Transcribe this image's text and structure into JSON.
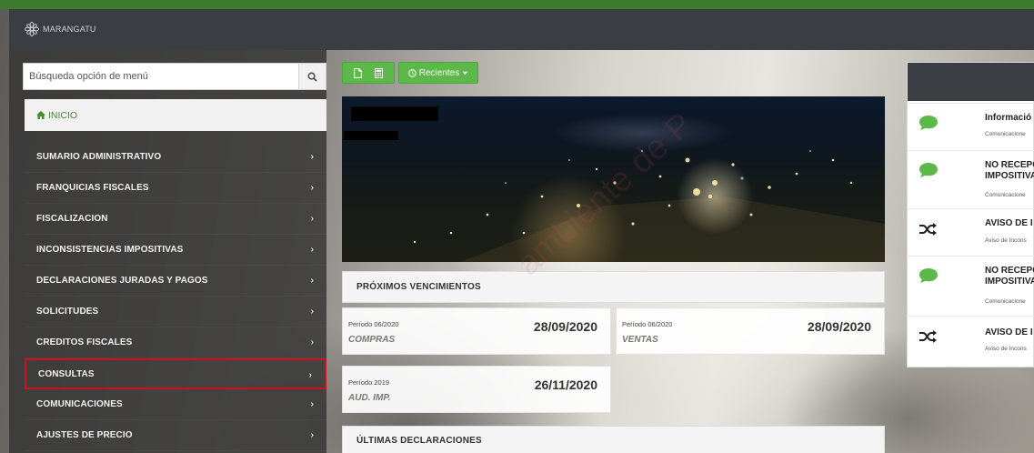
{
  "brand": {
    "name": "MARANGATU"
  },
  "colors": {
    "accent": "#5cb848",
    "topbar": "#3a3d42",
    "highlight": "#d0111b"
  },
  "search": {
    "placeholder": "Búsqueda opción de menú",
    "icon": "search-icon"
  },
  "home": {
    "label": "INICIO",
    "icon": "home-icon"
  },
  "menu": {
    "items": [
      {
        "label": "SUMARIO ADMINISTRATIVO"
      },
      {
        "label": "FRANQUICIAS FISCALES"
      },
      {
        "label": "FISCALIZACION"
      },
      {
        "label": "INCONSISTENCIAS IMPOSITIVAS"
      },
      {
        "label": "DECLARACIONES JURADAS Y PAGOS"
      },
      {
        "label": "SOLICITUDES"
      },
      {
        "label": "CREDITOS FISCALES"
      },
      {
        "label": "CONSULTAS"
      },
      {
        "label": "COMUNICACIONES"
      },
      {
        "label": "AJUSTES DE PRECIO"
      }
    ],
    "chevron": "›"
  },
  "toolbar": {
    "new_doc_icon": "file-icon",
    "calc_icon": "calculator-icon",
    "recent_label": "Recientes"
  },
  "due": {
    "title": "PRÓXIMOS VENCIMIENTOS",
    "cards": [
      {
        "period": "Período 06/2020",
        "date": "28/09/2020",
        "type": "COMPRAS"
      },
      {
        "period": "Período 06/2020",
        "date": "28/09/2020",
        "type": "VENTAS"
      },
      {
        "period": "Período 2019",
        "date": "26/11/2020",
        "type": "AUD. IMP."
      }
    ]
  },
  "last_declarations": {
    "title": "ÚLTIMAS DECLARACIONES"
  },
  "notifications": [
    {
      "icon": "comment-icon",
      "title": [
        "Informació"
      ],
      "sub": "Comunicacione"
    },
    {
      "icon": "comment-icon",
      "title": [
        "NO RECEPC",
        "IMPOSITIVA"
      ],
      "sub": "Comunicacione"
    },
    {
      "icon": "shuffle-icon",
      "title": [
        "AVISO DE I"
      ],
      "sub": "Aviso de Incons"
    },
    {
      "icon": "comment-icon",
      "title": [
        "NO RECEPC",
        "IMPOSITIVA"
      ],
      "sub": "Comunicacione"
    },
    {
      "icon": "shuffle-icon",
      "title": [
        "AVISO DE I"
      ],
      "sub": "Aviso de Incons"
    }
  ],
  "watermark": "ambiente de P"
}
